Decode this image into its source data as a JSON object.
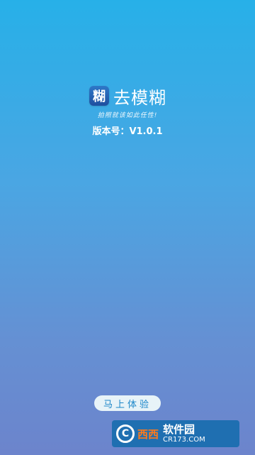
{
  "splash": {
    "icon_glyph": "糊",
    "app_name": "去模糊",
    "tagline": "拍照就该如此任性!",
    "version_text": "版本号：V1.0.1",
    "try_button_label": "马上体验"
  },
  "watermark": {
    "mark": "C",
    "brand": "西西",
    "name": "软件园",
    "url": "CR173.COM"
  },
  "colors": {
    "gradient_top": "#27b0e8",
    "gradient_bottom": "#6c84cc",
    "button_text": "#1c87c9",
    "watermark_brand": "#ff7a1a"
  }
}
